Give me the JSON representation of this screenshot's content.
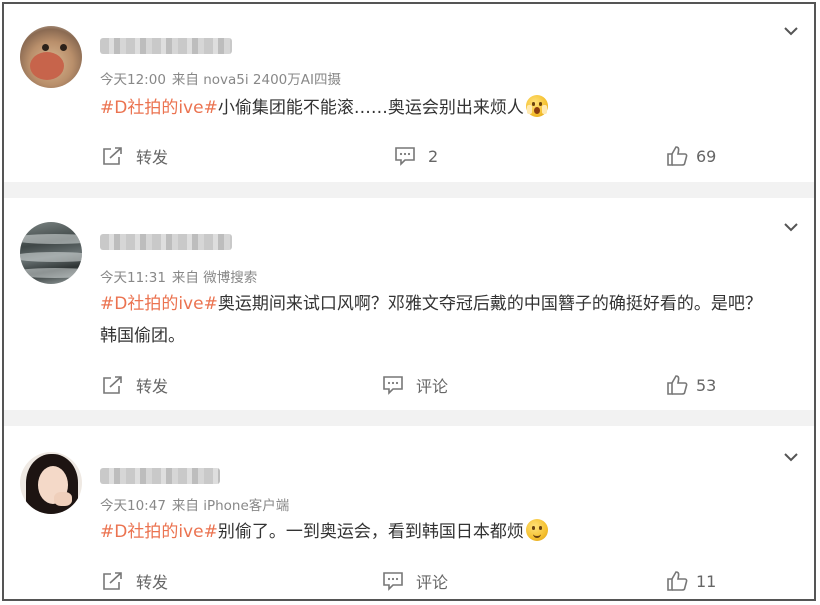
{
  "posts": [
    {
      "time": "今天12:00",
      "source": "来自 nova5i 2400万AI四摄",
      "tag": "#D社拍的ive#",
      "text_lines": [
        "小偷集团能不能滚……奥运会别出来烦人"
      ],
      "emoji": "fright-emoji",
      "share_label": "转发",
      "comment_label": "2",
      "like_count": "69"
    },
    {
      "time": "今天11:31",
      "source": "来自 微博搜索",
      "tag": "#D社拍的ive#",
      "text_lines": [
        "奥运期间来试口风啊？邓雅文夺冠后戴的中国簪子的确挺好看的。是吧？",
        "韩国偷团。"
      ],
      "share_label": "转发",
      "comment_label": "评论",
      "like_count": "53"
    },
    {
      "time": "今天10:47",
      "source": "来自 iPhone客户端",
      "tag": "#D社拍的ive#",
      "text_lines": [
        "别偷了。一到奥运会，看到韩国日本都烦"
      ],
      "emoji": "smile-emoji",
      "share_label": "转发",
      "comment_label": "评论",
      "like_count": "11"
    }
  ],
  "colors": {
    "tag": "#eb7350",
    "meta": "#888888",
    "separator": "#f2f2f2"
  }
}
